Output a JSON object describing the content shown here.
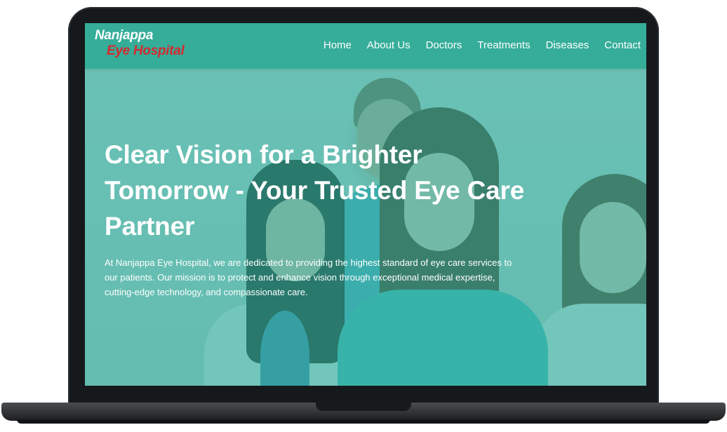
{
  "brand": {
    "line1": "Nanjappa",
    "line2": "Eye Hospital",
    "line1_color": "#ffffff",
    "line2_color": "#d42a2f"
  },
  "nav": {
    "items": [
      {
        "label": "Home"
      },
      {
        "label": "About Us"
      },
      {
        "label": "Doctors"
      },
      {
        "label": "Treatments"
      },
      {
        "label": "Diseases"
      },
      {
        "label": "Contact"
      }
    ]
  },
  "hero": {
    "title": "Clear Vision for a Brighter Tomorrow - Your Trusted Eye Care Partner",
    "description": "At Nanjappa Eye Hospital, we are dedicated to providing the highest standard of eye care services to our patients. Our mission is to protect and enhance vision through exceptional medical expertise, cutting-edge technology, and compassionate care."
  },
  "colors": {
    "navbar": "#35ad99",
    "overlay": "#26aa98",
    "laptop_frame": "#16191c"
  }
}
